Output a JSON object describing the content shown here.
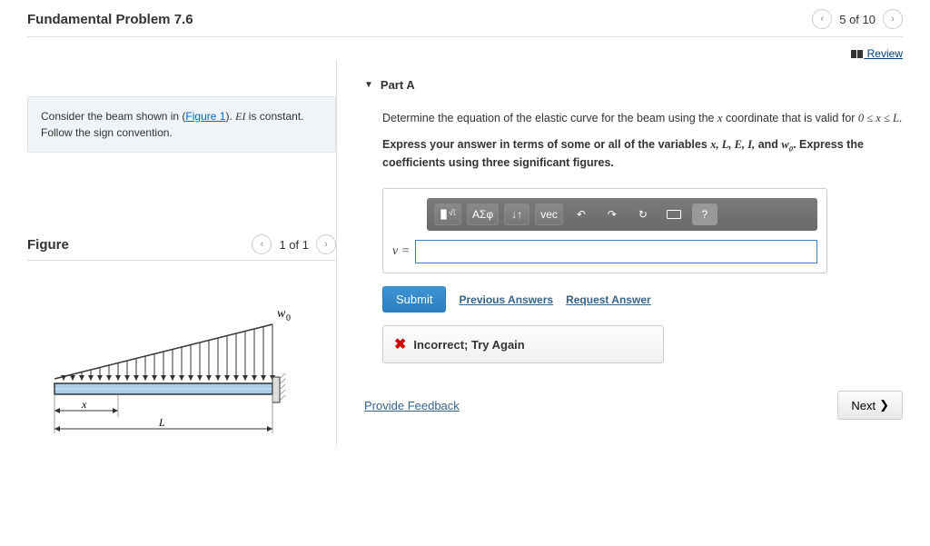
{
  "header": {
    "title": "Fundamental Problem 7.6",
    "position": "5 of 10"
  },
  "review_label": "Review",
  "info": {
    "text_before": "Consider the beam shown in (",
    "figure_link": "Figure 1",
    "text_after": "). ",
    "ei": "EI",
    "text_tail": " is constant. Follow the sign convention."
  },
  "figure": {
    "heading": "Figure",
    "position": "1 of 1",
    "load_label": "w",
    "load_sub": "0",
    "x_label": "x",
    "length_label": "L"
  },
  "part": {
    "label": "Part A",
    "question_before": "Determine the equation of the elastic curve for the beam using the ",
    "var_x": "x",
    "question_mid": " coordinate that is valid for ",
    "range": "0 ≤ x ≤ L",
    "question_after": ".",
    "instr_before": "Express your answer in terms of some or all of the variables ",
    "vars": "x, L, E, I,",
    "instr_and": " and ",
    "var_w0": "w",
    "w0_sub": "0",
    "instr_after": ". Express the coefficients using three significant figures.",
    "toolbar": {
      "greek": "ΑΣφ",
      "arrows": "↓↑",
      "vec": "vec",
      "undo": "↶",
      "redo": "↷",
      "reset": "↻",
      "help": "?"
    },
    "var_label": "v =",
    "submit": "Submit",
    "prev_answers": "Previous Answers",
    "request_answer": "Request Answer",
    "feedback": "Incorrect; Try Again"
  },
  "footer": {
    "provide": "Provide Feedback",
    "next": "Next"
  }
}
